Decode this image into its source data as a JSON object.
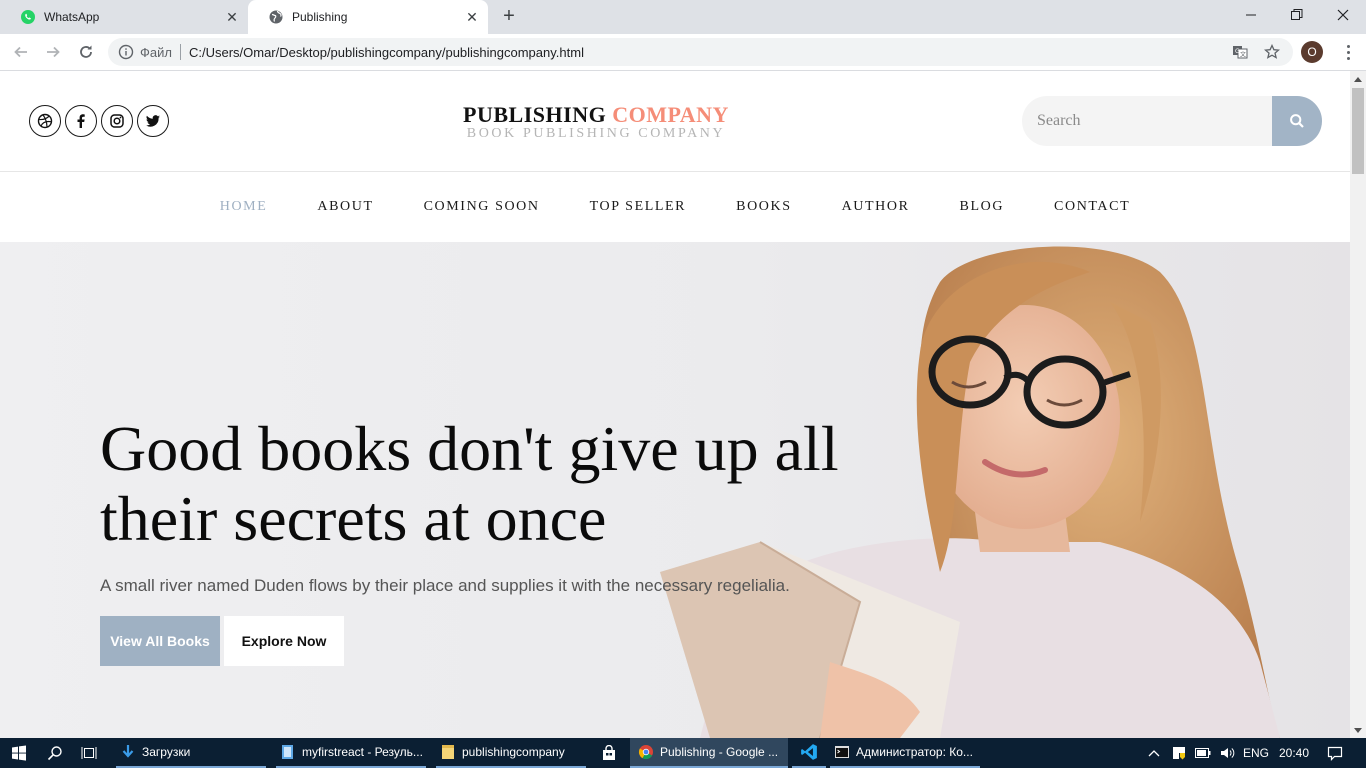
{
  "browser": {
    "tabs": [
      {
        "label": "WhatsApp",
        "icon": "whatsapp-icon"
      },
      {
        "label": "Publishing",
        "icon": "globe-icon"
      }
    ],
    "address": {
      "scheme": "Файл",
      "url": "C:/Users/Omar/Desktop/publishingcompany/publishingcompany.html"
    },
    "profile_initial": "O"
  },
  "site": {
    "brand_main": "PUBLISHING",
    "brand_accent": "COMPANY",
    "brand_tagline": "BOOK PUBLISHING COMPANY",
    "search_placeholder": "Search",
    "social": [
      "dribbble-icon",
      "facebook-icon",
      "instagram-icon",
      "twitter-icon"
    ],
    "nav": [
      "HOME",
      "ABOUT",
      "COMING SOON",
      "TOP SELLER",
      "BOOKS",
      "AUTHOR",
      "BLOG",
      "CONTACT"
    ],
    "hero": {
      "headline": "Good books don't give up all their secrets at once",
      "subtext": "A small river named Duden flows by their place and supplies it with the necessary regelialia.",
      "primary_button": "View All Books",
      "secondary_button": "Explore Now"
    },
    "colors": {
      "accent": "#f58d78",
      "primary": "#9fb1c3",
      "nav_active": "#9fb0c2"
    }
  },
  "taskbar": {
    "items": [
      {
        "label": "Загрузки",
        "icon": "download-icon"
      },
      {
        "label": "myfirstreact - Резуль...",
        "icon": "vs-icon"
      },
      {
        "label": "publishingcompany",
        "icon": "folder-icon"
      },
      {
        "label": "",
        "icon": "store-icon"
      },
      {
        "label": "Publishing - Google ...",
        "icon": "chrome-icon"
      },
      {
        "label": "",
        "icon": "vscode-icon"
      },
      {
        "label": "Администратор: Ко...",
        "icon": "cmd-icon"
      }
    ],
    "language": "ENG",
    "time": "20:40"
  }
}
